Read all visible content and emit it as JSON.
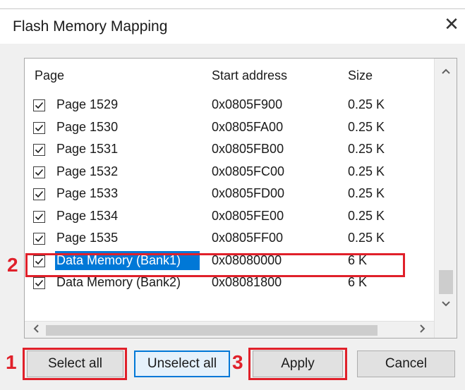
{
  "dialog": {
    "title": "Flash Memory Mapping",
    "close_glyph": "✕"
  },
  "table": {
    "columns": [
      "Page",
      "Start address",
      "Size"
    ],
    "rows": [
      {
        "page": "Page 1529",
        "address": "0x0805F900",
        "size": "0.25 K",
        "checked": true,
        "selected": false
      },
      {
        "page": "Page 1530",
        "address": "0x0805FA00",
        "size": "0.25 K",
        "checked": true,
        "selected": false
      },
      {
        "page": "Page 1531",
        "address": "0x0805FB00",
        "size": "0.25 K",
        "checked": true,
        "selected": false
      },
      {
        "page": "Page 1532",
        "address": "0x0805FC00",
        "size": "0.25 K",
        "checked": true,
        "selected": false
      },
      {
        "page": "Page 1533",
        "address": "0x0805FD00",
        "size": "0.25 K",
        "checked": true,
        "selected": false
      },
      {
        "page": "Page 1534",
        "address": "0x0805FE00",
        "size": "0.25 K",
        "checked": true,
        "selected": false
      },
      {
        "page": "Page 1535",
        "address": "0x0805FF00",
        "size": "0.25 K",
        "checked": true,
        "selected": false
      },
      {
        "page": "Data Memory (Bank1)",
        "address": "0x08080000",
        "size": "6 K",
        "checked": true,
        "selected": true
      },
      {
        "page": "Data Memory (Bank2)",
        "address": "0x08081800",
        "size": "6 K",
        "checked": true,
        "selected": false
      }
    ]
  },
  "buttons": {
    "select_all": "Select all",
    "unselect_all": "Unselect all",
    "apply": "Apply",
    "cancel": "Cancel"
  },
  "annotations": {
    "marker_1": "1",
    "marker_2": "2",
    "marker_3": "3",
    "color": "#e0202a"
  },
  "colors": {
    "selection": "#0078d7",
    "focus_border": "#0078d7"
  },
  "icons": {
    "scroll_up": "chevron-up-icon",
    "scroll_down": "chevron-down-icon",
    "scroll_left": "chevron-left-icon",
    "scroll_right": "chevron-right-icon",
    "checkbox": "checkmark-icon"
  }
}
